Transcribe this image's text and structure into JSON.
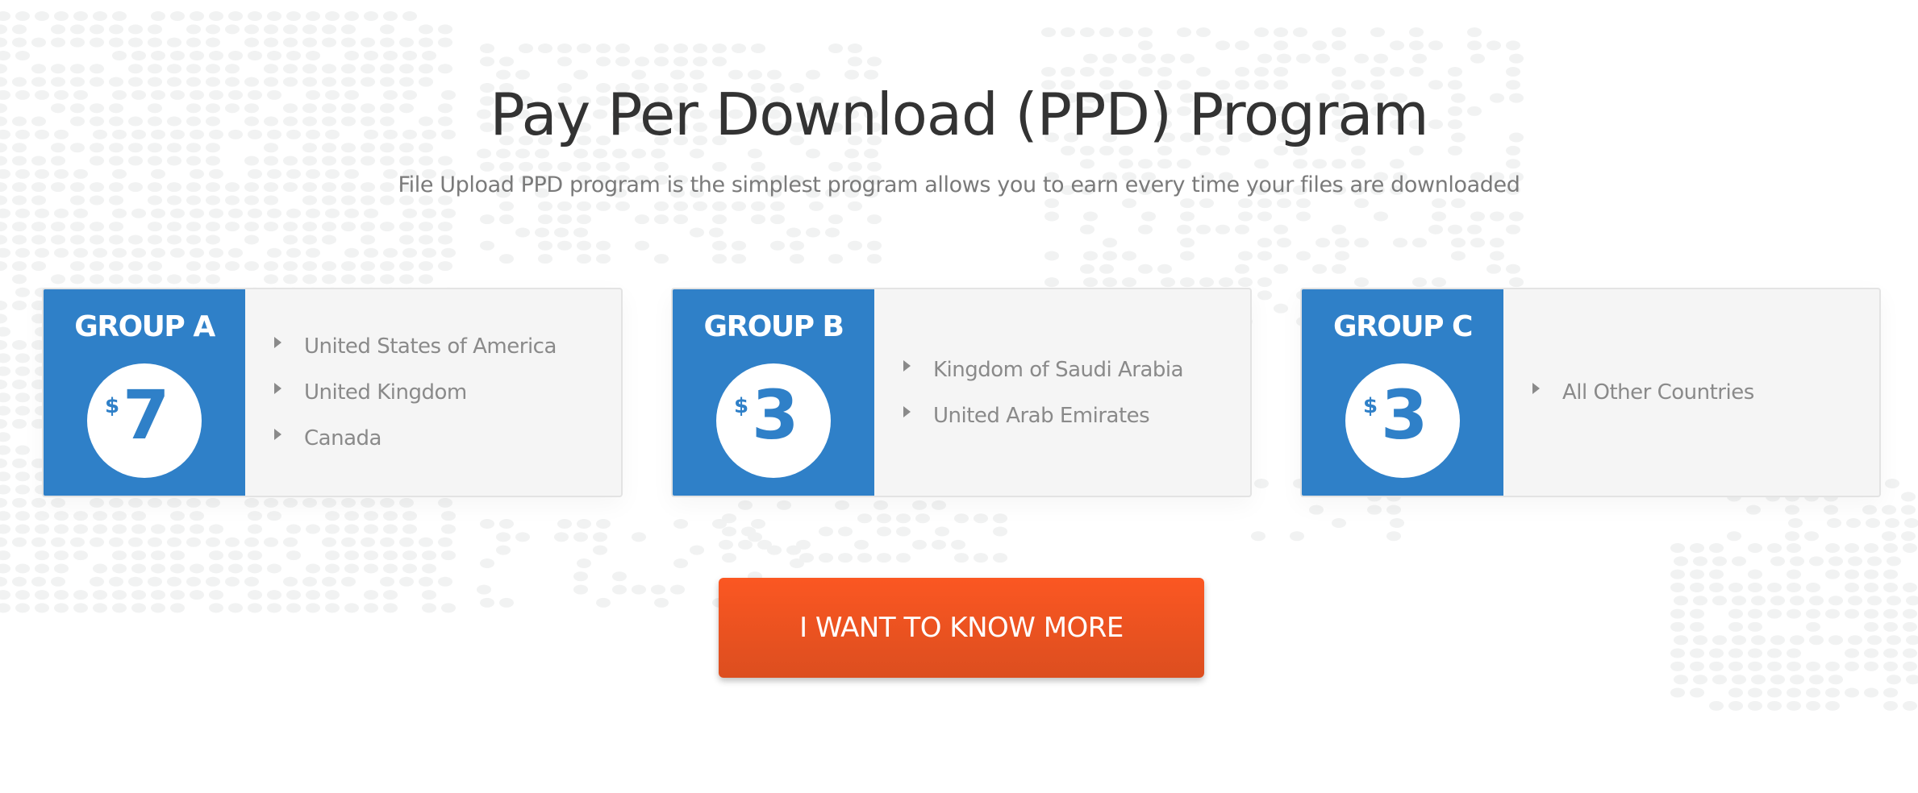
{
  "header": {
    "title": "Pay Per Download (PPD) Program",
    "subtitle": "File Upload PPD program is the simplest program allows you to earn every time your files are downloaded"
  },
  "groups": [
    {
      "name": "GROUP A",
      "currency": "$",
      "amount": "7",
      "countries": [
        "United States of America",
        "United Kingdom",
        "Canada"
      ]
    },
    {
      "name": "GROUP B",
      "currency": "$",
      "amount": "3",
      "countries": [
        "Kingdom of Saudi Arabia",
        "United Arab Emirates"
      ]
    },
    {
      "name": "GROUP C",
      "currency": "$",
      "amount": "3",
      "countries": [
        "All Other Countries"
      ]
    }
  ],
  "cta": {
    "label": "I WANT TO KNOW MORE"
  },
  "colors": {
    "brand_blue": "#2f80c8",
    "cta_orange": "#fb5722",
    "title_text": "#333333",
    "muted_text": "#8a8a8a",
    "card_bg": "#f5f5f5"
  },
  "icons": {
    "list_bullet": "caret-right-icon",
    "background": "dotted-world-map"
  }
}
